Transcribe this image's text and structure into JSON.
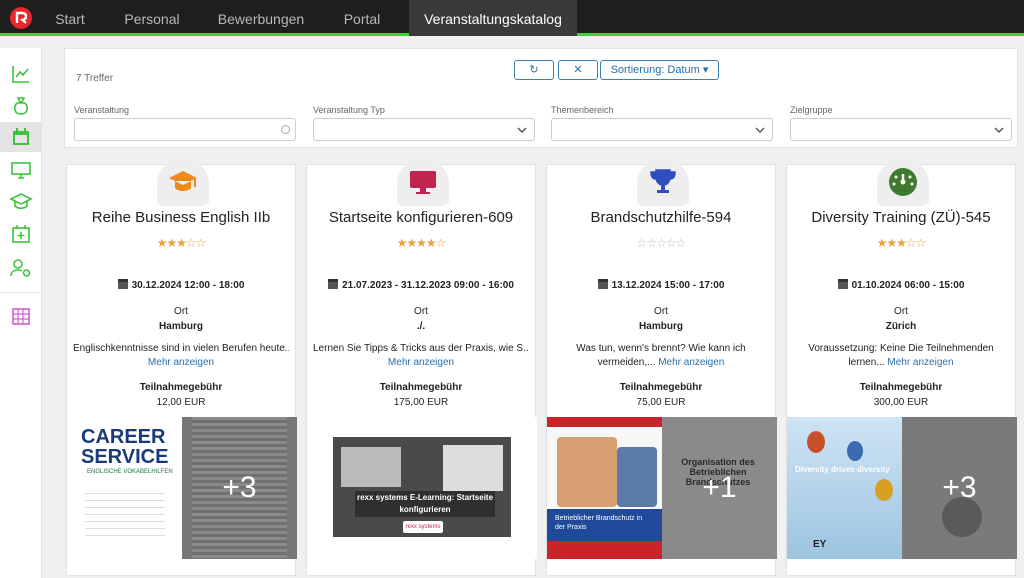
{
  "nav": {
    "tabs": [
      "Start",
      "Personal",
      "Bewerbungen",
      "Portal",
      "Veranstaltungskatalog"
    ]
  },
  "toolbar": {
    "hits": "7 Treffer",
    "refresh_icon": "↻",
    "clear_icon": "✕",
    "sort": "Sortierung: Datum"
  },
  "filters": {
    "veranstaltung": "Veranstaltung",
    "typ": "Veranstaltung Typ",
    "thema": "Themenbereich",
    "zielgruppe": "Zielgruppe"
  },
  "sidebar": {
    "icons": [
      "chart-line-icon",
      "money-bag-icon",
      "calendar-icon",
      "monitor-icon",
      "graduation-cap-icon",
      "calendar-plus-icon",
      "users-gear-icon",
      "calendar-grid-icon"
    ]
  },
  "cards": [
    {
      "title": "Reihe Business English IIb",
      "rating": 3.5,
      "stars": "★★★☆☆",
      "date": "30.12.2024 12:00 - 18:00",
      "ort_label": "Ort",
      "ort": "Hamburg",
      "desc": "Englischkenntnisse sind in vielen Berufen heute...",
      "more": "Mehr anzeigen",
      "fee_label": "Teilnahmegebühr",
      "fee": "12,00 EUR",
      "plus": "+3",
      "icon": "graduation-cap-icon",
      "icon_color": "#f08a1c",
      "img_left": "CAREER SERVICE",
      "img_left_sub": "ENGLISCHE VOKABELHILFEN"
    },
    {
      "title": "Startseite konfigurieren-609",
      "rating": 4,
      "stars": "★★★★☆",
      "date": "21.07.2023 - 31.12.2023 09:00 - 16:00",
      "ort_label": "Ort",
      "ort": "./.",
      "desc": "Lernen Sie Tipps & Tricks aus der Praxis, wie S...",
      "more": "Mehr anzeigen",
      "fee_label": "Teilnahmegebühr",
      "fee": "175,00 EUR",
      "plus": "",
      "icon": "monitor-icon",
      "icon_color": "#c0244e",
      "img_left": "rexx systems E-Learning: Startseite konfigurieren",
      "img_left_sub": "rexx systems"
    },
    {
      "title": "Brandschutzhilfe-594",
      "rating": 0,
      "stars": "☆☆☆☆☆",
      "date": "13.12.2024 15:00 - 17:00",
      "ort_label": "Ort",
      "ort": "Hamburg",
      "desc": "Was tun, wenn's brennt? Wie kann ich vermeiden,...",
      "more": "Mehr anzeigen",
      "fee_label": "Teilnahmegebühr",
      "fee": "75,00 EUR",
      "plus": "+1",
      "icon": "trophy-icon",
      "icon_color": "#2f4ec0",
      "img_left": "Betrieblicher Brandschutz in der Praxis",
      "img_left_sub": "Organisation des Betrieblichen Brandschutzes"
    },
    {
      "title": "Diversity Training (ZÜ)-545",
      "rating": 3.5,
      "stars": "★★★☆☆",
      "date": "01.10.2024 06:00 - 15:00",
      "ort_label": "Ort",
      "ort": "Zürich",
      "desc": "Voraussetzung: Keine Die Teilnehmenden lernen...",
      "more": "Mehr anzeigen",
      "fee_label": "Teilnahmegebühr",
      "fee": "300,00 EUR",
      "plus": "+3",
      "icon": "gauge-icon",
      "icon_color": "#3f7a2e",
      "img_left": "Diversity drives diversity",
      "img_left_sub": "EY"
    }
  ]
}
